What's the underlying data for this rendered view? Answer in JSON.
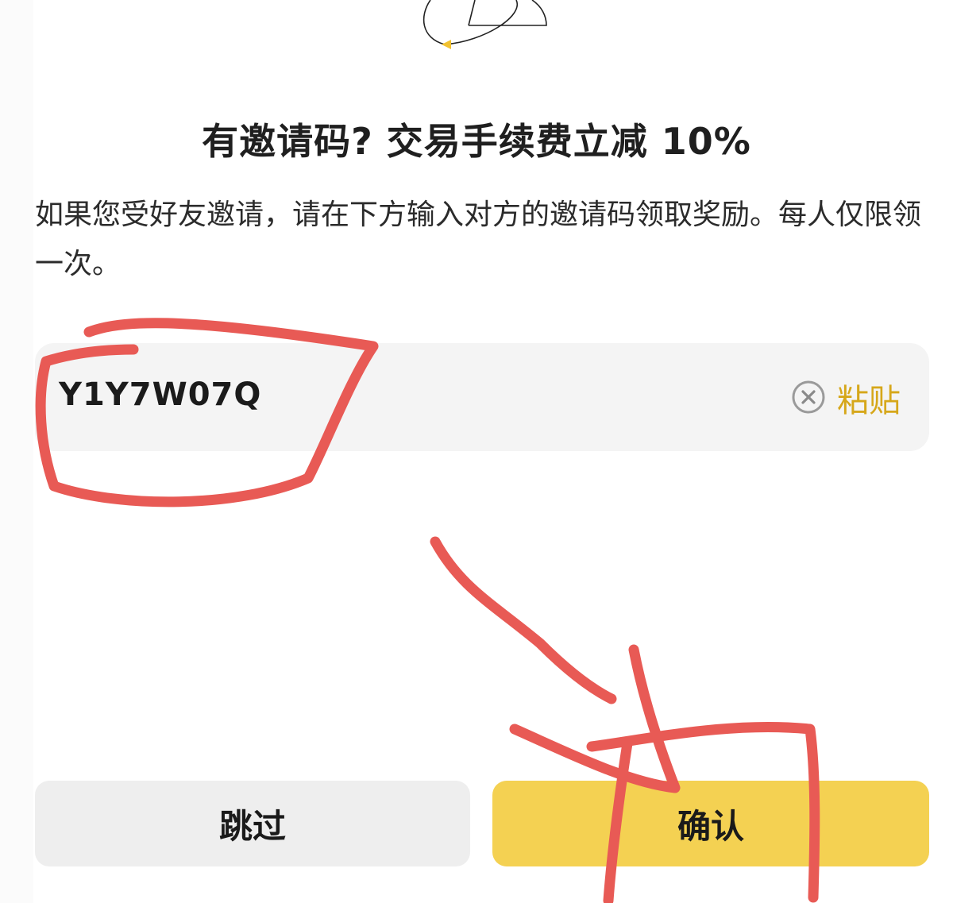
{
  "header": {
    "title": "有邀请码? 交易手续费立减 10%",
    "description": "如果您受好友邀请，请在下方输入对方的邀请码领取奖励。每人仅限领一次。"
  },
  "invite_field": {
    "value": "Y1Y7W07Q",
    "clear_icon": "clear-circle-icon",
    "paste_label": "粘贴"
  },
  "actions": {
    "skip_label": "跳过",
    "confirm_label": "确认"
  },
  "colors": {
    "accent_yellow": "#F4D152",
    "paste_text": "#D6A71A",
    "annotation_red": "#E85A55",
    "field_bg": "#F4F4F4",
    "skip_bg": "#EEEEEE"
  }
}
